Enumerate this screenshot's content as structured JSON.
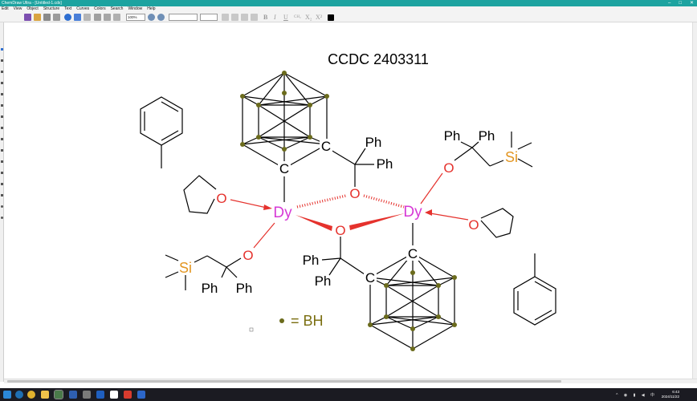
{
  "window": {
    "title": "ChemDraw Ultra - [Untitled-1.cdx]"
  },
  "menu": [
    "Edit",
    "View",
    "Object",
    "Structure",
    "Text",
    "Curves",
    "Colors",
    "Search",
    "Window",
    "Help"
  ],
  "toolbar": {
    "zoom": "100%"
  },
  "doc": {
    "title": "CCDC 2403311",
    "legend_eq": "= BH",
    "labels": {
      "dy": "Dy",
      "o": "O",
      "c": "C",
      "si": "Si",
      "ph": "Ph"
    }
  },
  "colors": {
    "titlebar": "#1da3a0",
    "dy": "#d63ad6",
    "oxygen": "#e5322d",
    "silicon": "#e39622",
    "boron_dot": "#6b6b1c",
    "bh_text": "#7a6e10",
    "bond": "#000000"
  },
  "taskbar": {
    "time": "6:43",
    "date": "2024/11/22"
  }
}
